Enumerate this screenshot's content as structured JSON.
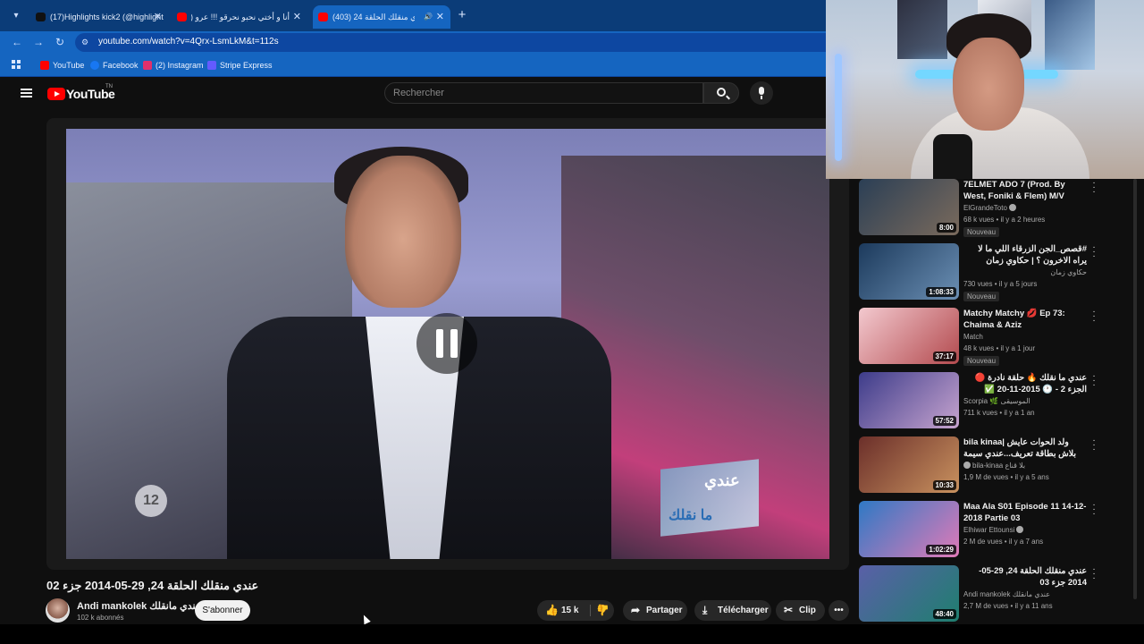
{
  "browser": {
    "tabs": [
      {
        "title": "(17)Highlights kick2 (@highlight",
        "active": false,
        "favicon_color": "#111111"
      },
      {
        "title": "أنا و أختي نحبو نحرقو !!! عرو (403)",
        "active": false,
        "favicon_color": "#ff0000"
      },
      {
        "title": "عندي منقلك الحلقة 24 (403)",
        "active": true,
        "favicon_color": "#ff0000",
        "audio": "🔊"
      }
    ],
    "new_tab": "+",
    "url": "youtube.com/watch?v=4Qrx-LsmLkM&t=112s",
    "bookmarks": [
      {
        "label": "YouTube",
        "color": "#ff0000"
      },
      {
        "label": "Facebook",
        "color": "#1877f2"
      },
      {
        "label": "(2) Instagram",
        "color": "#e1306c"
      },
      {
        "label": "Stripe Express",
        "color": "#635bff"
      }
    ]
  },
  "header": {
    "logo_text": "YouTube",
    "logo_suffix": "TN",
    "search_placeholder": "Rechercher"
  },
  "video": {
    "overlay_logo": "12",
    "overlay_show_top": "عندي",
    "overlay_show_bottom": "ما نقلك",
    "state": "paused"
  },
  "below": {
    "title": "عندي منقلك الحلقة 24, 29-05-2014 جزء 02",
    "channel_name": "Andi mankolek عندي مانقلك",
    "subscribers": "102 k abonnés",
    "subscribe_label": "S'abonner",
    "likes": "15 k",
    "share_label": "Partager",
    "download_label": "Télécharger",
    "clip_label": "Clip",
    "more_label": "•••"
  },
  "recommendations": [
    {
      "title": "7ELMET ADO 7 (Prod. By West, Foniki & Flem) M/V",
      "channel": "ElGrandeToto",
      "verified": true,
      "meta": "68 k vues • il y a 2 heures",
      "badge": "Nouveau",
      "duration": "8:00",
      "thumb": [
        "#2b3f55",
        "#7a6a5c"
      ]
    },
    {
      "title": "#قصص_الجن الزرقاء اللي ما لا يراه الاخرون ؟ | حكاوي زمان",
      "channel": "حكاوي زمان",
      "verified": false,
      "meta": "730 vues • il y a 5 jours",
      "badge": "Nouveau",
      "duration": "1:08:33",
      "thumb": [
        "#1c3a5c",
        "#6b8fb4"
      ]
    },
    {
      "title": "Matchy Matchy 💋 Ep 73: Chaima & Aziz",
      "channel": "Match",
      "verified": false,
      "meta": "48 k vues • il y a 1 jour",
      "badge": "Nouveau",
      "duration": "37:17",
      "thumb": [
        "#f3c9cf",
        "#b34a4e"
      ]
    },
    {
      "title": "عندي ما نقلك 🔥 حلقة نادرة 🔴 الجزء 2 - 🕐 2015-11-20 ✅",
      "channel": "Scorpia 🌿 الموسيقى",
      "verified": false,
      "meta": "711 k vues • il y a 1 an",
      "badge": "",
      "duration": "57:52",
      "thumb": [
        "#3d3c8a",
        "#c7a4cf"
      ]
    },
    {
      "title": "bila kinaa| ولد الحوات عايش بلاش بطاقة تعريف...عندي سيمة عشر منشور فيكش",
      "channel": "bila-kinaa بلا قناع",
      "verified": true,
      "meta": "1,9 M de vues • il y a 5 ans",
      "badge": "",
      "duration": "10:33",
      "thumb": [
        "#6b2f2a",
        "#c9925f"
      ]
    },
    {
      "title": "Maa Ala S01 Episode 11 14-12-2018 Partie 03",
      "channel": "Elhiwar Ettounsi",
      "verified": true,
      "meta": "2 M de vues • il y a 7 ans",
      "badge": "",
      "duration": "1:02:29",
      "thumb": [
        "#2f79c4",
        "#e07ab8"
      ]
    },
    {
      "title": "عندي منقلك الحلقة 24, 29-05-2014 جزء 03",
      "channel": "Andi mankolek عندي مانقلك",
      "verified": false,
      "meta": "2,7 M de vues • il y a 11 ans",
      "badge": "",
      "duration": "48:40",
      "thumb": [
        "#5a5fa8",
        "#1f7f6f"
      ]
    }
  ]
}
